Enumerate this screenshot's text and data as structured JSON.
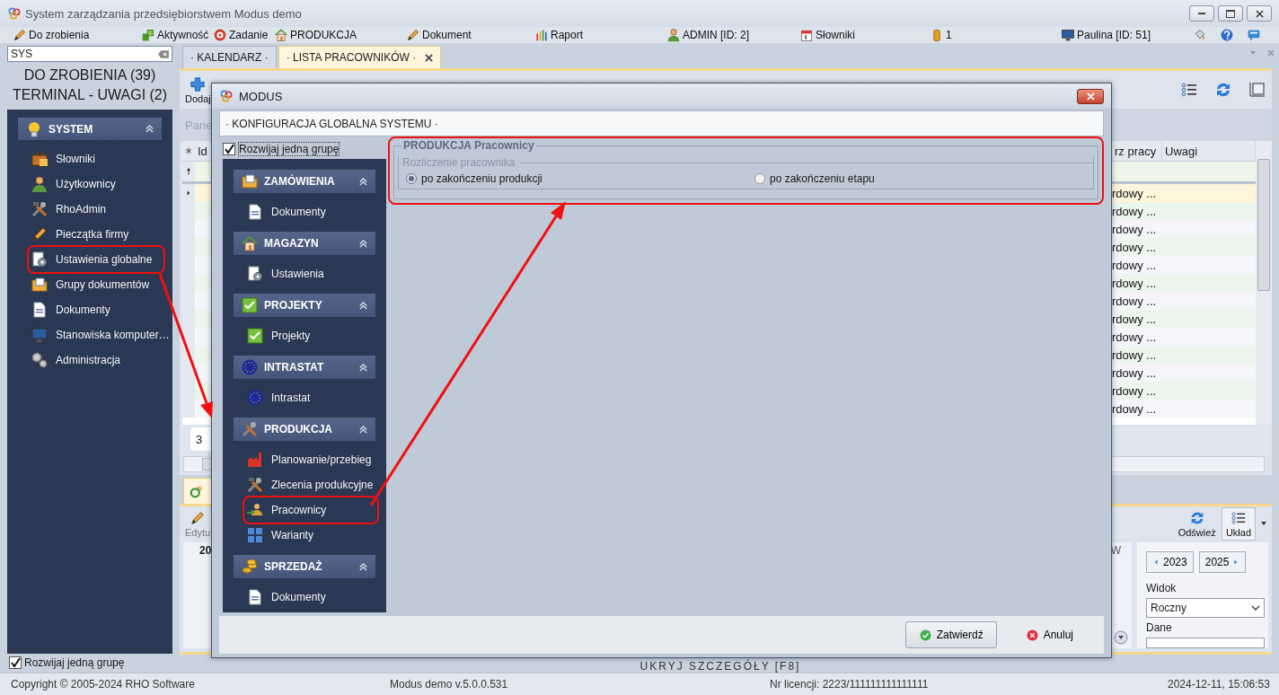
{
  "window": {
    "title": "System zarządzania przedsiębiorstwem Modus demo"
  },
  "menu_bar": [
    {
      "label": "Do zrobienia"
    },
    {
      "label": "Aktywność"
    },
    {
      "label": "Zadanie"
    },
    {
      "label": "PRODUKCJA"
    },
    {
      "label": "Dokument"
    },
    {
      "label": "Raport"
    },
    {
      "label": "ADMIN [ID: 2]"
    },
    {
      "label": "Słowniki"
    },
    {
      "label": "1"
    },
    {
      "label": "Paulina [ID: 51]"
    }
  ],
  "search": {
    "value": "SYS"
  },
  "counters": [
    "DO ZROBIENIA (39)",
    "TERMINAL - UWAGI (2)"
  ],
  "sidebar": {
    "groups": [
      {
        "title": "SYSTEM",
        "expanded": true,
        "items": [
          {
            "label": "Słowniki",
            "annotated": false
          },
          {
            "label": "Użytkownicy",
            "annotated": false
          },
          {
            "label": "RhoAdmin",
            "annotated": false
          },
          {
            "label": "Pieczątka firmy",
            "annotated": false
          },
          {
            "label": "Ustawienia globalne",
            "annotated": true
          },
          {
            "label": "Grupy dokumentów",
            "annotated": false
          },
          {
            "label": "Dokumenty",
            "annotated": false
          },
          {
            "label": "Stanowiska komputer…",
            "annotated": false
          },
          {
            "label": "Administracja",
            "annotated": false
          }
        ]
      }
    ],
    "expand_one_group": {
      "label": "Rozwijaj jedną grupę",
      "checked": true
    }
  },
  "tabs": [
    {
      "label": "· KALENDARZ ·",
      "selected": false
    },
    {
      "label": "· LISTA PRACOWNIKÓW ·",
      "selected": true
    }
  ],
  "list": {
    "toolbar": [
      {
        "label": "Dodaj"
      }
    ],
    "panel_label": "Pane",
    "columns": [
      "Id",
      "rz pracy",
      "Uwagi"
    ],
    "rows": [
      {
        "column_3": "rdowy ...",
        "selected": true
      },
      {
        "column_3": "rdowy ...",
        "selected": false
      },
      {
        "column_3": "rdowy ...",
        "selected": false
      },
      {
        "column_3": "rdowy ...",
        "selected": false
      },
      {
        "column_3": "rdowy ...",
        "selected": false
      },
      {
        "column_3": "rdowy ...",
        "selected": false
      },
      {
        "column_3": "rdowy ...",
        "selected": false
      },
      {
        "column_3": "rdowy ...",
        "selected": false
      },
      {
        "column_3": "rdowy ...",
        "selected": false
      },
      {
        "column_3": "rdowy ...",
        "selected": false
      },
      {
        "column_3": "rdowy ...",
        "selected": false
      },
      {
        "column_3": "rdowy ...",
        "selected": false
      },
      {
        "column_3": "rdowy ...",
        "selected": false
      }
    ],
    "footer_value": "3"
  },
  "details": {
    "edit": "Edytu",
    "refresh": "Odśwież",
    "layout": "Układ",
    "calendar_column_1": "20",
    "calendar_column_2": "W",
    "year_prev": "2023",
    "year_next": "2025",
    "view_label": "Widok",
    "view": "Roczny",
    "data_label": "Dane",
    "hide_label": "UKRYJ SZCZEGÓŁY [F8]"
  },
  "dialog": {
    "title": "MODUS",
    "header": "· KONFIGURACJA GLOBALNA SYSTEMU ·",
    "expand_one_group": {
      "label": "Rozwijaj jedną grupę",
      "checked": true
    },
    "groups": [
      {
        "title": "ZAMÓWIENIA",
        "expanded": true,
        "items": [
          {
            "label": "Dokumenty",
            "annotated": false
          }
        ]
      },
      {
        "title": "MAGAZYN",
        "expanded": true,
        "items": [
          {
            "label": "Ustawienia",
            "annotated": false
          }
        ]
      },
      {
        "title": "PROJEKTY",
        "expanded": true,
        "items": [
          {
            "label": "Projekty",
            "annotated": false
          }
        ]
      },
      {
        "title": "INTRASTAT",
        "expanded": true,
        "items": [
          {
            "label": "Intrastat",
            "annotated": false
          }
        ]
      },
      {
        "title": "PRODUKCJA",
        "expanded": true,
        "items": [
          {
            "label": "Planowanie/przebieg",
            "annotated": false
          },
          {
            "label": "Zlecenia produkcyjne",
            "annotated": false
          },
          {
            "label": "Pracownicy",
            "annotated": true
          },
          {
            "label": "Warianty",
            "annotated": false
          }
        ]
      },
      {
        "title": "SPRZEDAŻ",
        "expanded": true,
        "items": [
          {
            "label": "Dokumenty",
            "annotated": false
          }
        ]
      }
    ],
    "settings": {
      "title": "PRODUKCJA Pracownicy",
      "annotated": true,
      "section": "Rozliczenie pracownika",
      "options": [
        {
          "label": "po zakończeniu produkcji",
          "selected": true
        },
        {
          "label": "po zakończeniu etapu",
          "selected": false
        }
      ]
    },
    "buttons": {
      "ok": "Zatwierdź",
      "cancel": "Anuluj"
    }
  },
  "status_bar": [
    "Copyright © 2005-2024 RHO Software",
    "Modus demo v.5.0.0.531",
    "Nr licencji: 2223/111111111111111",
    "2024-12-11, 15:06:53"
  ]
}
